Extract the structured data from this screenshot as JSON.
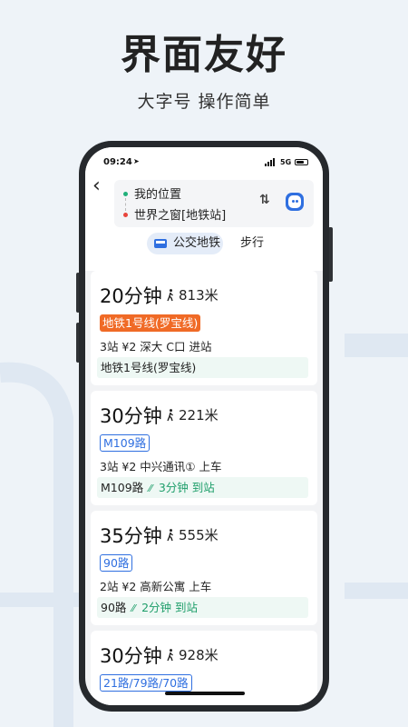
{
  "promo": {
    "title": "界面友好",
    "subtitle": "大字号 操作简单"
  },
  "status_bar": {
    "time": "09:24",
    "network": "5G"
  },
  "route": {
    "origin": "我的位置",
    "destination": "世界之窗[地铁站]"
  },
  "tabs": {
    "active": "公交地铁",
    "other": "步行"
  },
  "plans": [
    {
      "duration": "20分钟",
      "walk": "813米",
      "badge": "地铁1号线(罗宝线)",
      "badge_type": "metro",
      "info": "3站  ¥2  深大 C口 进站",
      "detail": "地铁1号线(罗宝线)",
      "eta": ""
    },
    {
      "duration": "30分钟",
      "walk": "221米",
      "badge": "M109路",
      "badge_type": "bus",
      "info": "3站  ¥2  中兴通讯① 上车",
      "detail": "M109路",
      "eta": "3分钟 到站"
    },
    {
      "duration": "35分钟",
      "walk": "555米",
      "badge": "90路",
      "badge_type": "bus",
      "info": "2站  ¥2  高新公寓 上车",
      "detail": "90路",
      "eta": "2分钟 到站"
    },
    {
      "duration": "30分钟",
      "walk": "928米",
      "badge": "21路/79路/70路",
      "badge_type": "bus",
      "info": "",
      "detail": "",
      "eta": ""
    }
  ],
  "colors": {
    "metro": "#f06a26",
    "bus": "#2f6fe0",
    "eta": "#1e9e6a"
  }
}
